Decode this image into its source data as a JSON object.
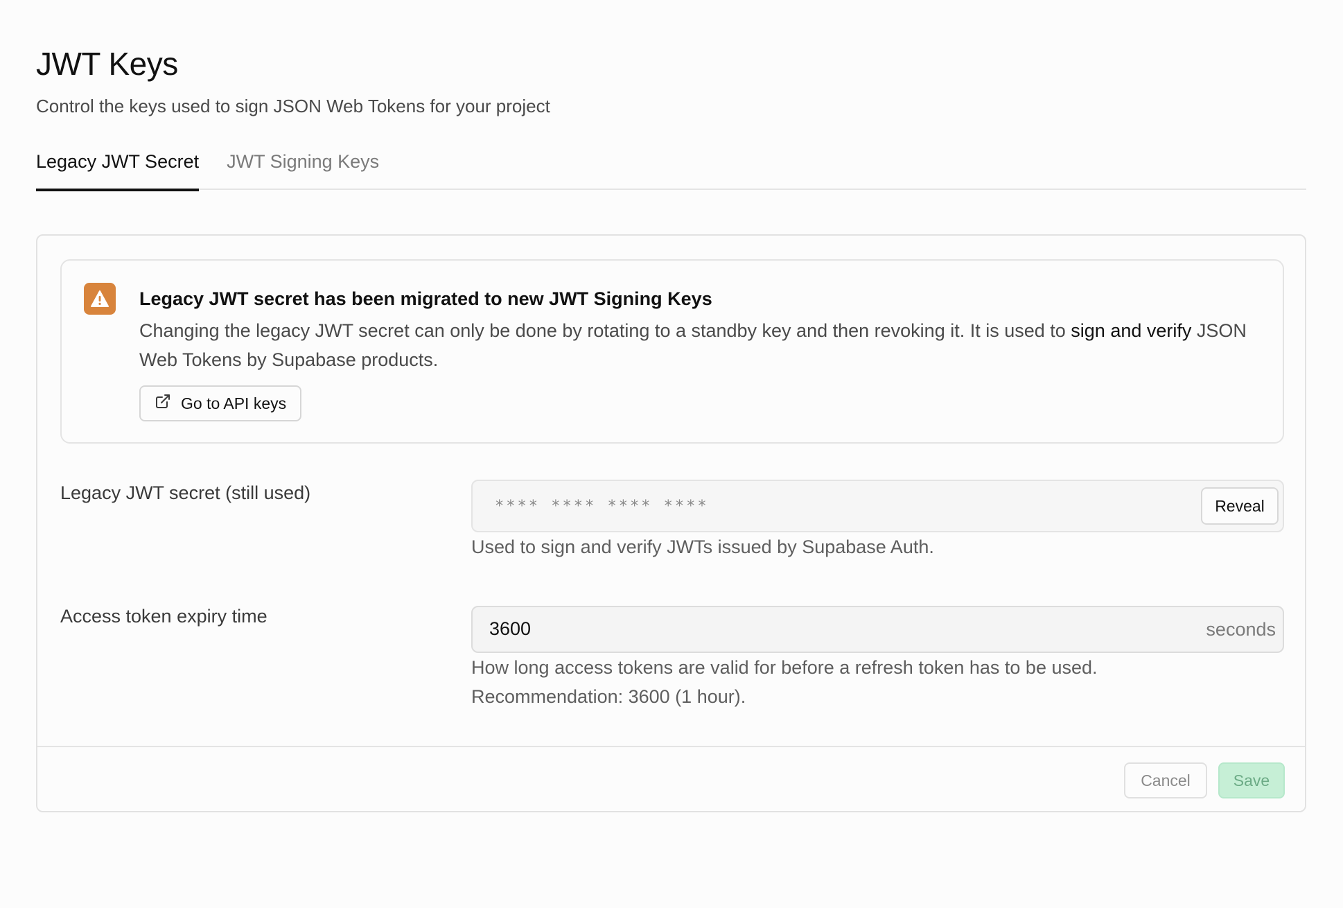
{
  "header": {
    "title": "JWT Keys",
    "subtitle": "Control the keys used to sign JSON Web Tokens for your project"
  },
  "tabs": [
    {
      "label": "Legacy JWT Secret",
      "active": true
    },
    {
      "label": "JWT Signing Keys",
      "active": false
    }
  ],
  "alert": {
    "icon": "warning-icon",
    "accent_color": "#d8843c",
    "title": "Legacy JWT secret has been migrated to new JWT Signing Keys",
    "body_prefix": "Changing the legacy JWT secret can only be done by rotating to a standby key and then revoking it. It is used to ",
    "body_emphasis": "sign and verify",
    "body_suffix": " JSON Web Tokens by Supabase products.",
    "button_label": "Go to API keys",
    "button_icon": "external-link-icon"
  },
  "secret_field": {
    "label": "Legacy JWT secret (still used)",
    "masked_value": "****  ****  ****  ****",
    "reveal_label": "Reveal",
    "help": "Used to sign and verify JWTs issued by Supabase Auth."
  },
  "expiry_field": {
    "label": "Access token expiry time",
    "value": "3600",
    "suffix": "seconds",
    "help_line1": "How long access tokens are valid for before a refresh token has to be used.",
    "help_line2": "Recommendation: 3600 (1 hour)."
  },
  "footer": {
    "cancel_label": "Cancel",
    "save_label": "Save",
    "save_color": "#c6efd6"
  }
}
